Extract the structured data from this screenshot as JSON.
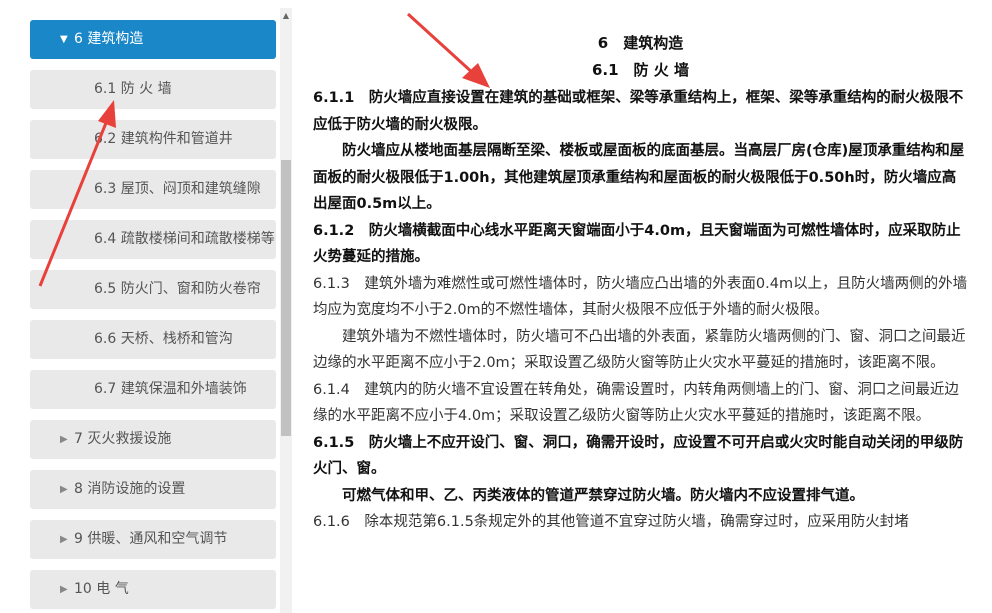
{
  "sidebar": {
    "items": [
      {
        "label": "6 建筑构造",
        "level": 1,
        "state": "expanded-active"
      },
      {
        "label": "6.1 防 火 墙",
        "level": 2
      },
      {
        "label": "6.2 建筑构件和管道井",
        "level": 2
      },
      {
        "label": "6.3 屋顶、闷顶和建筑缝隙",
        "level": 2
      },
      {
        "label": "6.4 疏散楼梯间和疏散楼梯等",
        "level": 2
      },
      {
        "label": "6.5 防火门、窗和防火卷帘",
        "level": 2
      },
      {
        "label": "6.6 天桥、栈桥和管沟",
        "level": 2
      },
      {
        "label": "6.7 建筑保温和外墙装饰",
        "level": 2
      },
      {
        "label": "7 灭火救援设施",
        "level": 1,
        "state": "collapsed"
      },
      {
        "label": "8 消防设施的设置",
        "level": 1,
        "state": "collapsed"
      },
      {
        "label": "9 供暖、通风和空气调节",
        "level": 1,
        "state": "collapsed"
      },
      {
        "label": "10 电 气",
        "level": 1,
        "state": "collapsed"
      }
    ]
  },
  "content": {
    "chapter_title": "6　建筑构造",
    "section_title": "6.1　防 火 墙",
    "paragraphs": [
      {
        "text": "6.1.1　防火墙应直接设置在建筑的基础或框架、梁等承重结构上，框架、梁等承重结构的耐火极限不应低于防火墙的耐火极限。",
        "style": "bold"
      },
      {
        "text": "防火墙应从楼地面基层隔断至梁、楼板或屋面板的底面基层。当高层厂房(仓库)屋顶承重结构和屋面板的耐火极限低于1.00h，其他建筑屋顶承重结构和屋面板的耐火极限低于0.50h时，防火墙应高出屋面0.5m以上。",
        "style": "bold-indent"
      },
      {
        "text": "6.1.2　防火墙横截面中心线水平距离天窗端面小于4.0m，且天窗端面为可燃性墙体时，应采取防止火势蔓延的措施。",
        "style": "bold"
      },
      {
        "text": "6.1.3　建筑外墙为难燃性或可燃性墙体时，防火墙应凸出墙的外表面0.4m以上，且防火墙两侧的外墙均应为宽度均不小于2.0m的不燃性墙体，其耐火极限不应低于外墙的耐火极限。",
        "style": "normal"
      },
      {
        "text": "建筑外墙为不燃性墙体时，防火墙可不凸出墙的外表面，紧靠防火墙两侧的门、窗、洞口之间最近边缘的水平距离不应小于2.0m；采取设置乙级防火窗等防止火灾水平蔓延的措施时，该距离不限。",
        "style": "normal-indent"
      },
      {
        "text": "6.1.4　建筑内的防火墙不宜设置在转角处，确需设置时，内转角两侧墙上的门、窗、洞口之间最近边缘的水平距离不应小于4.0m；采取设置乙级防火窗等防止火灾水平蔓延的措施时，该距离不限。",
        "style": "normal"
      },
      {
        "text": "6.1.5　防火墙上不应开设门、窗、洞口，确需开设时，应设置不可开启或火灾时能自动关闭的甲级防火门、窗。",
        "style": "bold"
      },
      {
        "text": "可燃气体和甲、乙、丙类液体的管道严禁穿过防火墙。防火墙内不应设置排气道。",
        "style": "bold-indent"
      },
      {
        "text": "6.1.6　除本规范第6.1.5条规定外的其他管道不宜穿过防火墙，确需穿过时，应采用防火封堵",
        "style": "normal"
      }
    ]
  },
  "colors": {
    "active_nav": "#1a87c9",
    "nav_bg": "#e9e9e9",
    "annotation_arrow": "#e8403a"
  }
}
